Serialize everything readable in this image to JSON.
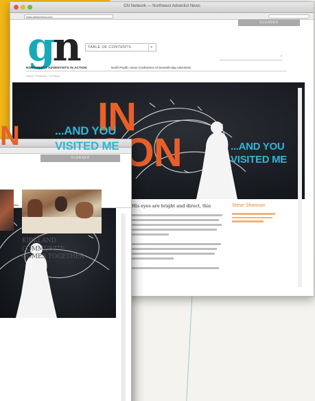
{
  "back_window": {
    "title": "GN Network — Northwest Adventist News",
    "url": "www.gleanernow.com",
    "header_tab_label": "GLEANER",
    "logo_g": "g",
    "logo_n": "n",
    "toc_label": "TABLE OF CONTENTS",
    "toc_caret": "▾",
    "tagline": "NORTHWEST ADVENTISTS IN ACTION",
    "subtitle": "North Pacific Union Conference of Seventh-day Adventists",
    "breadcrumb": "Home  ›  Features  ›  In Prison",
    "hero_big": "IN\nSON",
    "hero_and": "...AND YOU\nVISITED ME",
    "lead": "His eyes are bright and direct, this",
    "sidebar_heading": "Steve Shawson"
  },
  "front_window": {
    "header_tab_label": "GLEANER",
    "subtitle": "day Adventists",
    "hero_and": "...AND YOU\nVISITED ME",
    "hero_big": "N",
    "headline": "KIRKLAND\nCOMMUNITY\nCOMES TOGETHER"
  },
  "colors": {
    "accent_teal": "#16a9b8",
    "accent_orange": "#e7602a",
    "hero_cyan": "#2fb6d8",
    "sidebar_orange": "#e38a3a"
  },
  "icons": [
    "search-icon",
    "window-close-icon",
    "window-minimize-icon",
    "window-zoom-icon",
    "dropdown-caret-icon"
  ]
}
